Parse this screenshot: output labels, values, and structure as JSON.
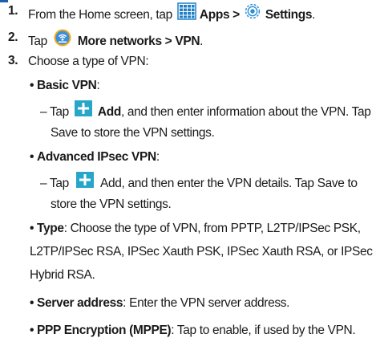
{
  "steps": [
    {
      "number": "1.",
      "lead": "From the Home screen, tap",
      "apps_label": "Apps >",
      "settings_label": "Settings",
      "end": "."
    },
    {
      "number": "2.",
      "lead": "Tap",
      "path_label": "More networks > VPN",
      "end": "."
    },
    {
      "number": "3.",
      "lead": "Choose a type of VPN:"
    }
  ],
  "basic": {
    "title": "Basic VPN",
    "colon": ":",
    "dash": "–",
    "tap": "Tap",
    "add_label": "Add",
    "rest1": ", and then enter information about the VPN. Tap",
    "rest2": "Save to store the VPN settings."
  },
  "advanced": {
    "title": "Advanced IPsec VPN",
    "colon": ":",
    "dash": "–",
    "tap": "Tap",
    "rest1": "Add, and then enter the VPN details. Tap Save to",
    "rest2": "store the VPN settings."
  },
  "type": {
    "title": "Type",
    "rest1": ": Choose the type of VPN, from PPTP, L2TP/IPSec PSK,",
    "rest2": "L2TP/IPSec RSA, IPSec Xauth PSK, IPSec Xauth RSA, or IPSec",
    "rest3": "Hybrid RSA."
  },
  "server": {
    "title": "Server address",
    "rest": ": Enter the VPN server address."
  },
  "ppp": {
    "title": "PPP Encryption (MPPE)",
    "rest": ": Tap to enable, if used by the VPN."
  },
  "bullet_char": "•",
  "colors": {
    "accent_blue": "#1f5fa8",
    "apps_icon": "#1f7fc6",
    "settings_icon": "#2a8fd6",
    "add_icon_bg": "#27a6c9",
    "wifi_icon": "#f2a81e"
  },
  "icons": [
    "apps-grid-icon",
    "settings-gear-icon",
    "wifi-more-networks-icon",
    "add-plus-icon"
  ]
}
